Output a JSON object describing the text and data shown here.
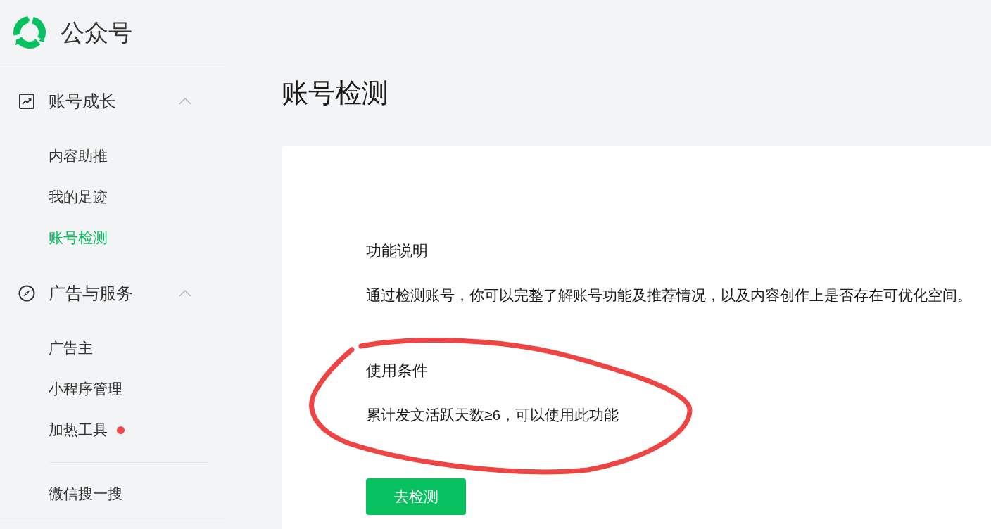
{
  "logo": {
    "title": "公众号"
  },
  "sidebar": {
    "groups": [
      {
        "title": "账号成长",
        "expanded": true,
        "items": [
          {
            "label": "内容助推",
            "selected": false,
            "dot": false
          },
          {
            "label": "我的足迹",
            "selected": false,
            "dot": false
          },
          {
            "label": "账号检测",
            "selected": true,
            "dot": false
          }
        ]
      },
      {
        "title": "广告与服务",
        "expanded": true,
        "items": [
          {
            "label": "广告主",
            "selected": false,
            "dot": false
          },
          {
            "label": "小程序管理",
            "selected": false,
            "dot": false
          },
          {
            "label": "加热工具",
            "selected": false,
            "dot": true
          }
        ]
      }
    ],
    "bottom_items": [
      {
        "label": "微信搜一搜",
        "selected": false
      }
    ]
  },
  "page_title": "账号检测",
  "sections": [
    {
      "heading": "功能说明",
      "text": "通过检测账号，你可以完整了解账号功能及推荐情况，以及内容创作上是否存在可优化空间。",
      "circled": false
    },
    {
      "heading": "使用条件",
      "text": "累计发文活跃天数≥6，可以使用此功能",
      "circled": true
    }
  ],
  "button": {
    "label": "去检测"
  }
}
